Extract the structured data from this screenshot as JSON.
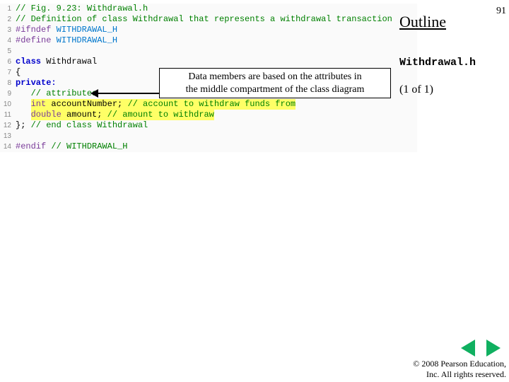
{
  "slide": {
    "title": "Outline",
    "number": "91"
  },
  "file": {
    "name": "Withdrawal.h",
    "page": "(1 of 1)"
  },
  "callout": {
    "line1": "Data members are based on the attributes in",
    "line2": "the middle compartment of the class diagram"
  },
  "code": {
    "l1": "// Fig. 9.23: Withdrawal.h",
    "l2": "// Definition of class Withdrawal that represents a withdrawal transaction",
    "l3a": "#ifndef",
    "l3b": "WITHDRAWAL_H",
    "l4a": "#define",
    "l4b": "WITHDRAWAL_H",
    "l6a": "class",
    "l6b": "Withdrawal",
    "l7": "{",
    "l8": "private:",
    "l9": "   // attributes",
    "l10a": "int",
    "l10b": "accountNumber;",
    "l10c": "// account to withdraw funds from",
    "l11a": "double",
    "l11b": "amount;",
    "l11c": "// amount to withdraw",
    "l12a": "};",
    "l12b": "// end class Withdrawal",
    "l14a": "#endif",
    "l14b": "// WITHDRAWAL_H"
  },
  "copyright": {
    "line1": "© 2008 Pearson Education,",
    "line2": "Inc.  All rights reserved."
  }
}
